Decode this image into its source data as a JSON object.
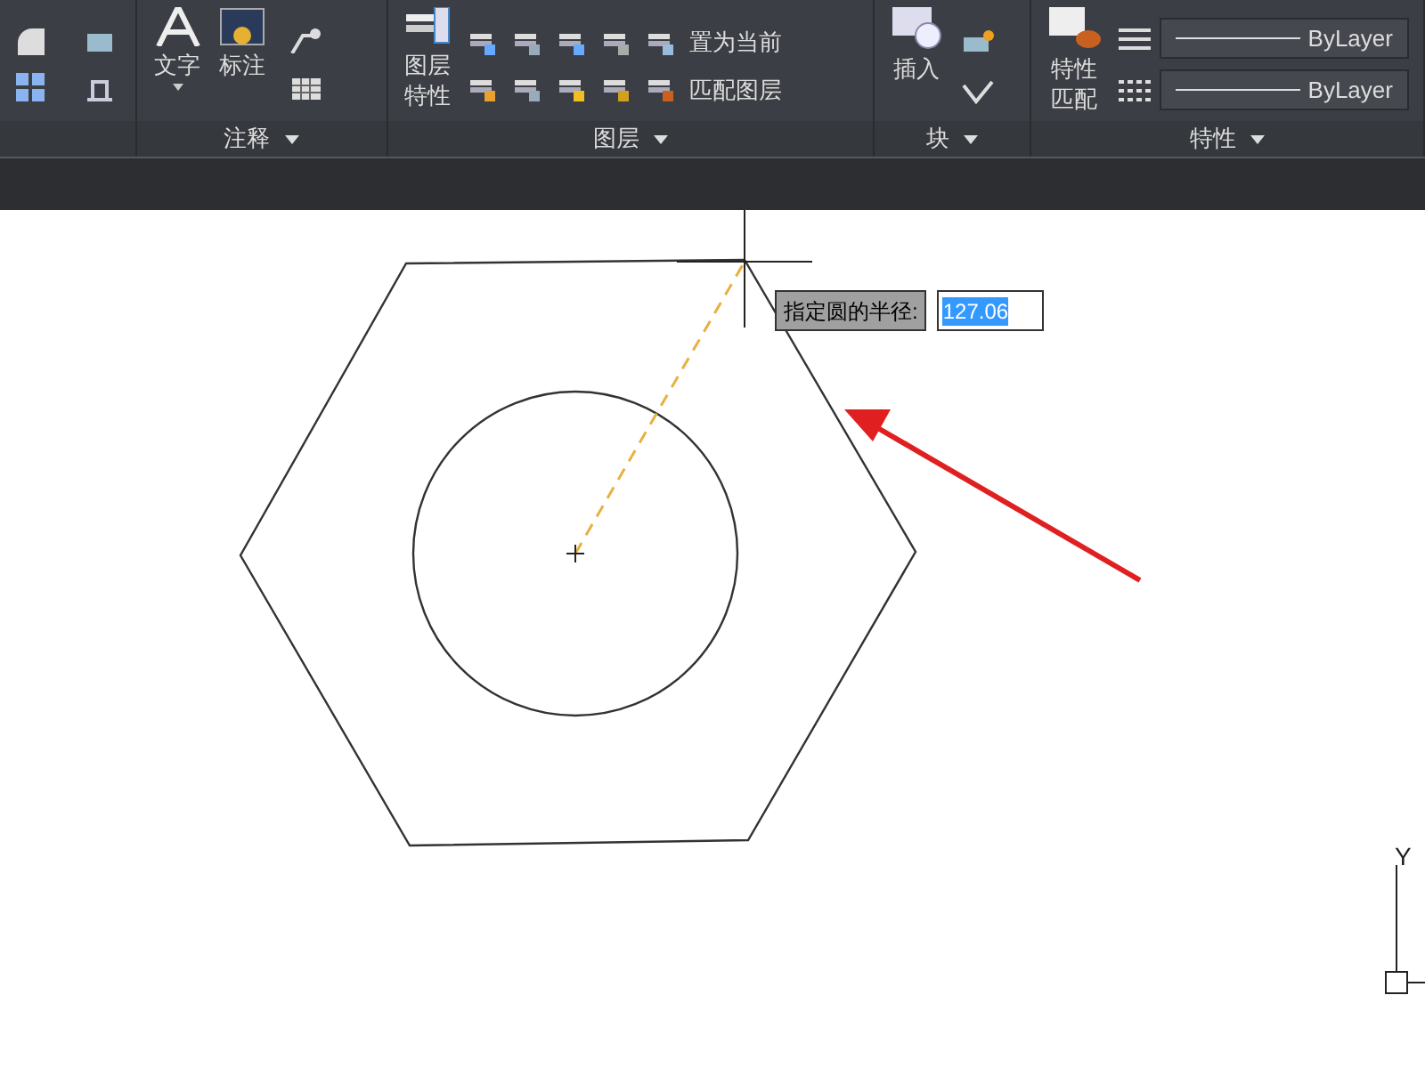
{
  "ribbon": {
    "panels": [
      {
        "kind": "icons_only"
      },
      {
        "title": "注释",
        "big_tools": [
          {
            "label": "文字",
            "dropdown": true
          },
          {
            "label": "标注",
            "dropdown": false
          }
        ]
      },
      {
        "title": "图层",
        "big_tools": [
          {
            "label": "图层特性",
            "dropdown": false
          }
        ],
        "small_rows": [
          {
            "label": "置为当前"
          },
          {
            "label": "匹配图层"
          }
        ]
      },
      {
        "title": "块",
        "big_tools": [
          {
            "label": "插入",
            "dropdown": false
          }
        ]
      },
      {
        "title": "特性",
        "big_tools": [
          {
            "label": "特性匹配",
            "dropdown": false
          }
        ],
        "combos": [
          {
            "value": "ByLayer"
          },
          {
            "value": "ByLayer"
          }
        ]
      }
    ]
  },
  "canvas": {
    "prompt": {
      "label": "指定圆的半径:",
      "value": "127.06",
      "value_selected": true
    },
    "ucs": {
      "axis_label": "Y"
    }
  }
}
